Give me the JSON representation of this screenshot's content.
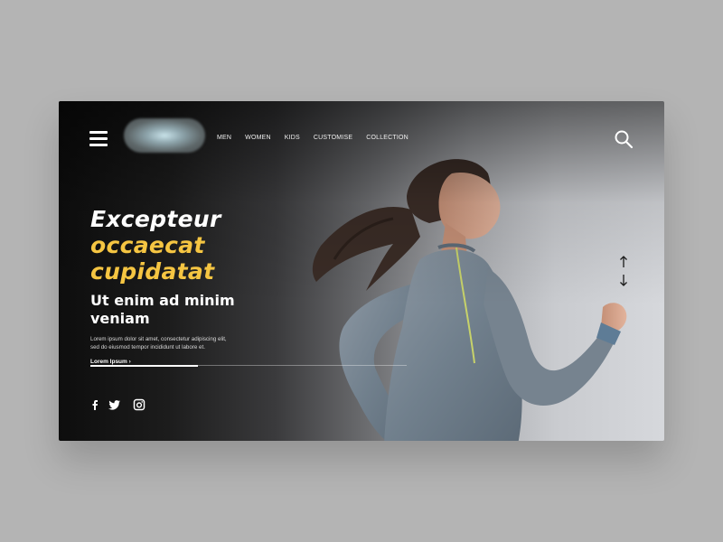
{
  "nav": {
    "items": [
      {
        "label": "MEN"
      },
      {
        "label": "WOMEN"
      },
      {
        "label": "KIDS"
      },
      {
        "label": "CUSTOMISE"
      },
      {
        "label": "COLLECTION"
      }
    ],
    "menu_icon": "hamburger-menu-icon",
    "search_icon": "search-icon"
  },
  "hero": {
    "title_line1": "Excepteur",
    "title_line2": "occaecat",
    "title_line3": "cupidatat",
    "subtitle": "Ut enim ad minim veniam",
    "description": "Lorem ipsum dolor sit amet, consectetur adipiscing elit, sed do eiusmod tempor incididunt ut labore et.",
    "link_label": "Lorem Ipsum",
    "link_arrow": "›"
  },
  "slider": {
    "progress": 0.34
  },
  "social": {
    "icons": [
      "facebook-icon",
      "twitter-icon",
      "instagram-icon"
    ]
  },
  "colors": {
    "accent": "#f5c542",
    "text": "#ffffff",
    "outer_background": "#b4b4b4"
  }
}
